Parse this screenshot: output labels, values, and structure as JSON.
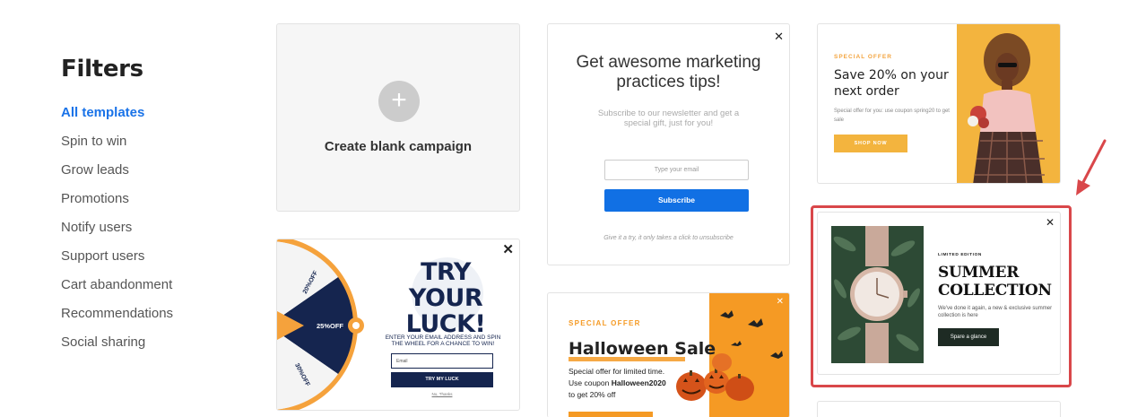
{
  "sidebar": {
    "title": "Filters",
    "items": [
      {
        "label": "All templates",
        "active": true
      },
      {
        "label": "Spin to win"
      },
      {
        "label": "Grow leads"
      },
      {
        "label": "Promotions"
      },
      {
        "label": "Notify users"
      },
      {
        "label": "Support users"
      },
      {
        "label": "Cart abandonment"
      },
      {
        "label": "Recommendations"
      },
      {
        "label": "Social sharing"
      }
    ]
  },
  "templates": {
    "blank": {
      "plus": "+",
      "label": "Create blank campaign"
    },
    "spin": {
      "title": "TRY YOUR LUCK!",
      "subtitle": "ENTER YOUR EMAIL ADDRESS AND SPIN THE WHEEL FOR A CHANCE TO WIN!",
      "input_placeholder": "Email",
      "button": "TRY MY LUCK",
      "no_thanks": "No, Thanks",
      "slices": [
        "20%OFF",
        "25%OFF",
        "30%OFF"
      ],
      "close": "✕"
    },
    "newsletter": {
      "title": "Get awesome marketing practices tips!",
      "description": "Subscribe to our newsletter and get a special gift, just for you!",
      "input_placeholder": "Type your email",
      "button": "Subscribe",
      "footer": "Give it a try, it only takes a click to unsubscribe",
      "close": "✕"
    },
    "halloween": {
      "tag": "SPECIAL OFFER",
      "title": "Halloween Sale",
      "desc_line1": "Special offer for limited time.",
      "desc_line2_pre": "Use coupon ",
      "desc_coupon": "Halloween2020",
      "desc_line3": "to get 20% off",
      "close": "✕"
    },
    "offer": {
      "tag": "SPECIAL OFFER",
      "title": "Save 20% on your next order",
      "description": "Special offer for you: use coupon spring20 to get sale",
      "button": "SHOP NOW"
    },
    "summer": {
      "tag": "LIMITED EDITION",
      "title": "SUMMER COLLECTION",
      "description": "We've done it again, a new & exclusive summer collection is here",
      "button": "Spare a glance",
      "close": "✕"
    }
  },
  "colors": {
    "accent_blue": "#1a73e8",
    "highlight_red": "#d9474a",
    "navy": "#15254f",
    "orange": "#f59a24"
  }
}
